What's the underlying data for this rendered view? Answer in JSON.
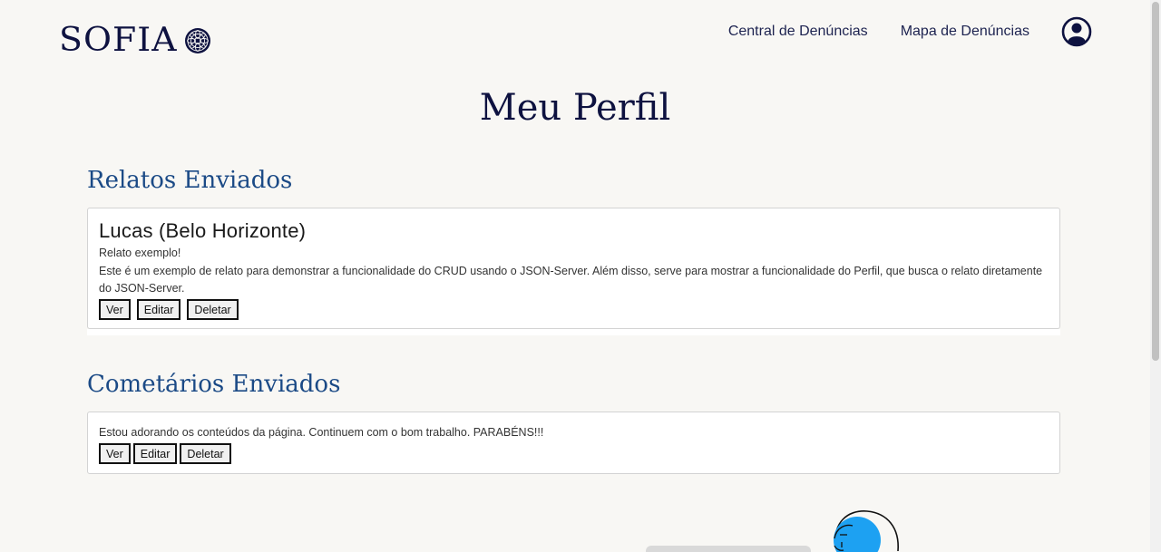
{
  "header": {
    "logo_text": "SOFIA",
    "nav": [
      {
        "label": "Central de Denúncias"
      },
      {
        "label": "Mapa de Denúncias"
      }
    ],
    "profile_icon": "user-circle-icon",
    "logo_mark_icon": "mandala-icon"
  },
  "page": {
    "title": "Meu Perfil"
  },
  "relatos": {
    "section_title": "Relatos Enviados",
    "items": [
      {
        "author": "Lucas (Belo Horizonte)",
        "subtitle": "Relato exemplo!",
        "body": "Este é um exemplo de relato para demonstrar a funcionalidade do CRUD usando o JSON-Server. Além disso, serve para mostrar a funcionalidade do Perfil, que busca o relato diretamente do JSON-Server.",
        "buttons": {
          "view": "Ver",
          "edit": "Editar",
          "delete": "Deletar"
        }
      }
    ]
  },
  "comentarios": {
    "section_title": "Cometários Enviados",
    "items": [
      {
        "body": "Estou adorando os conteúdos da página. Continuem com o bom trabalho. PARABÉNS!!!",
        "buttons": {
          "view": "Ver",
          "edit": "Editar",
          "delete": "Deletar"
        }
      }
    ]
  },
  "colors": {
    "background": "#f8f7f4",
    "navy": "#0e1240",
    "section_blue": "#1b4a86",
    "accent_blue": "#1da1f2"
  }
}
